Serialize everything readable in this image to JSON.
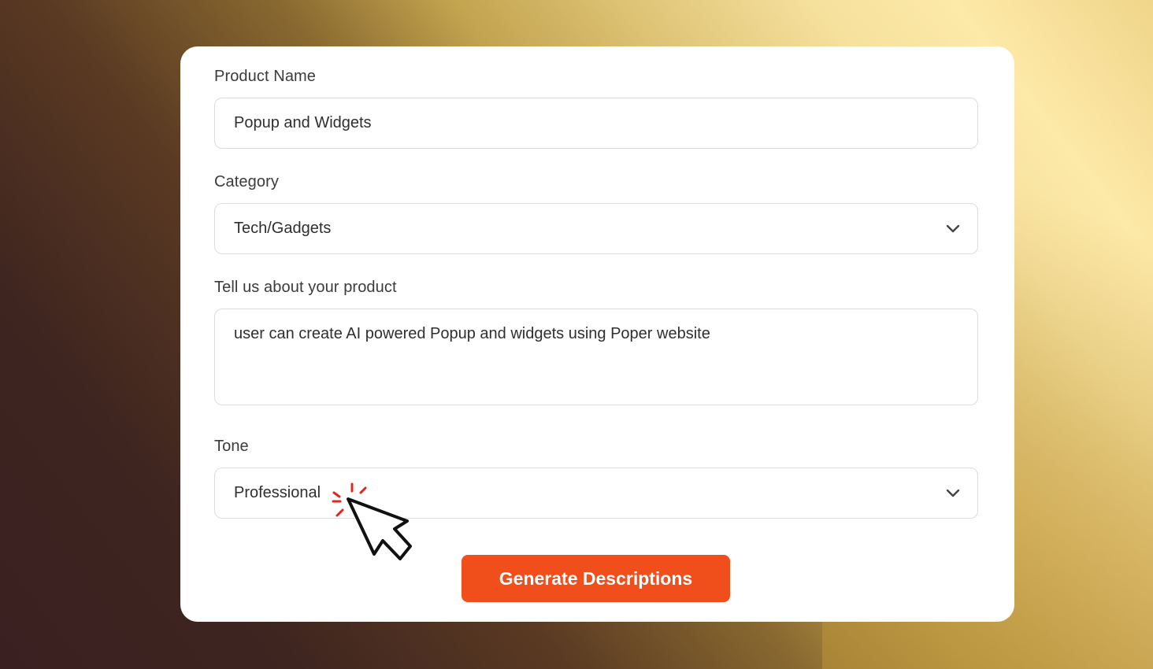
{
  "form": {
    "product_name_label": "Product Name",
    "product_name_value": "Popup and Widgets",
    "category_label": "Category",
    "category_value": "Tech/Gadgets",
    "about_label": "Tell us about your product",
    "about_value": "user can create AI powered Popup and widgets using Poper website",
    "tone_label": "Tone",
    "tone_value": "Professional",
    "submit_label": "Generate Descriptions"
  },
  "colors": {
    "accent": "#f04e1b",
    "click_spark": "#e5251b"
  },
  "icons": [
    "chevron-down-icon",
    "pointer-cursor-icon"
  ]
}
